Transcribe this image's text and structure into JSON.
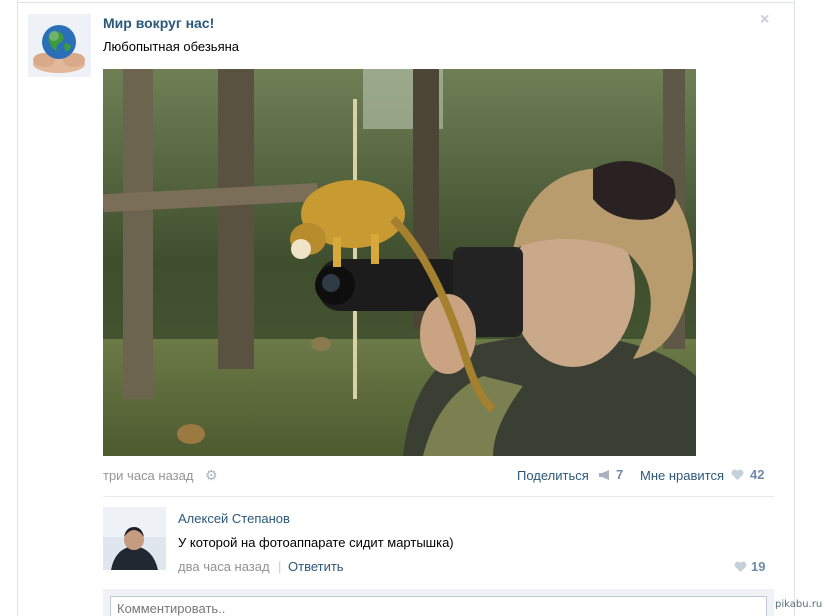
{
  "post": {
    "group_name": "Мир вокруг нас!",
    "text": "Любопытная обезьяна",
    "close_icon": "×",
    "time": "три часа назад",
    "share_label": "Поделиться",
    "share_count": "7",
    "like_label": "Мне нравится",
    "like_count": "42"
  },
  "comment": {
    "author": "Алексей Степанов",
    "text": "У которой на фотоаппарате сидит мартышка)",
    "time": "два часа назад",
    "separator": "|",
    "reply_label": "Ответить",
    "like_count": "19"
  },
  "comment_input": {
    "placeholder": "Комментировать.."
  },
  "watermark": "pikabu.ru",
  "colors": {
    "link": "#2b587a",
    "muted": "#939393",
    "count": "#6f8bab",
    "icon": "#aab3bd"
  }
}
